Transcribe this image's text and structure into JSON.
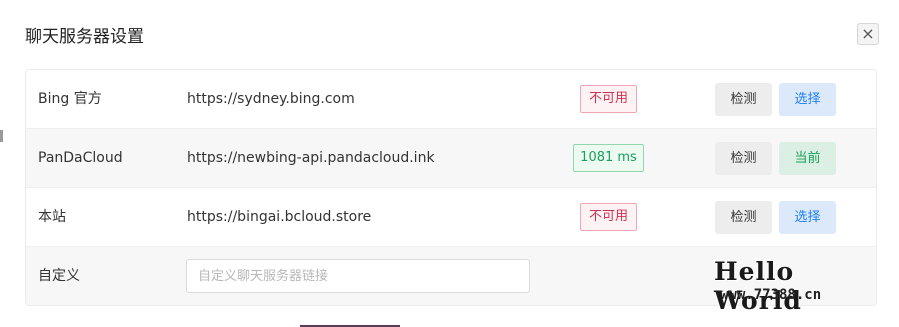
{
  "dialog": {
    "title": "聊天服务器设置",
    "close_icon": "×"
  },
  "servers": [
    {
      "name": "Bing 官方",
      "url": "https://sydney.bing.com",
      "status": "不可用",
      "status_type": "unavailable",
      "detect_label": "检测",
      "action_label": "选择",
      "action_type": "select"
    },
    {
      "name": "PanDaCloud",
      "url": "https://newbing-api.pandacloud.ink",
      "status": "1081 ms",
      "status_type": "ok",
      "detect_label": "检测",
      "action_label": "当前",
      "action_type": "current"
    },
    {
      "name": "本站",
      "url": "https://bingai.bcloud.store",
      "status": "不可用",
      "status_type": "unavailable",
      "detect_label": "检测",
      "action_label": "选择",
      "action_type": "select"
    }
  ],
  "custom": {
    "name": "自定义",
    "placeholder": "自定义聊天服务器链接",
    "value": ""
  },
  "watermark": {
    "title": "Hello World",
    "url": "www.77388.cn"
  },
  "colors": {
    "unavailable": "#d03050",
    "ok": "#18a058",
    "select": "#2080f0"
  }
}
